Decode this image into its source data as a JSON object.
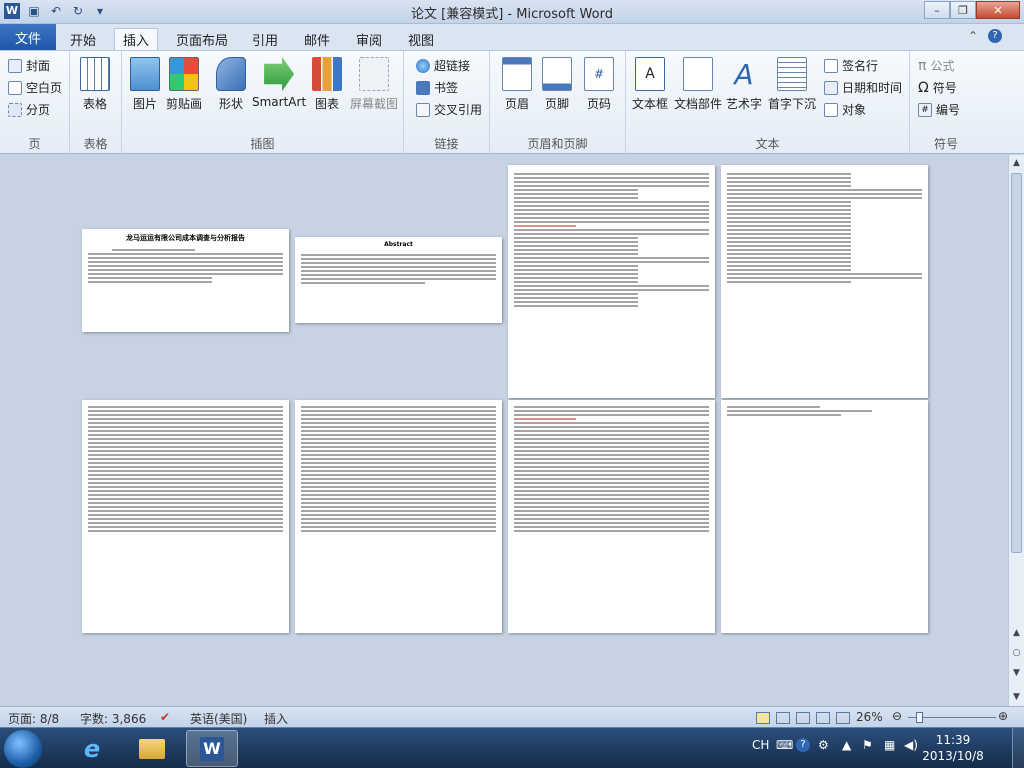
{
  "window": {
    "title": "论文 [兼容模式] - Microsoft Word",
    "minimize": "–",
    "restore": "❐",
    "close": "✕"
  },
  "tabs": {
    "file": "文件",
    "items": [
      "开始",
      "插入",
      "页面布局",
      "引用",
      "邮件",
      "审阅",
      "视图"
    ],
    "active": "插入"
  },
  "ribbon": {
    "pages": {
      "cover": "封面",
      "blank": "空白页",
      "break": "分页",
      "label": "页"
    },
    "tables": {
      "table": "表格",
      "label": "表格"
    },
    "illustrations": {
      "picture": "图片",
      "clipart": "剪贴画",
      "shapes": "形状",
      "smartart": "SmartArt",
      "chart": "图表",
      "screenshot": "屏幕截图",
      "label": "插图"
    },
    "links": {
      "hyperlink": "超链接",
      "bookmark": "书签",
      "crossref": "交叉引用",
      "label": "链接"
    },
    "headerfooter": {
      "header": "页眉",
      "footer": "页脚",
      "pagenum": "页码",
      "label": "页眉和页脚"
    },
    "text": {
      "textbox": "文本框",
      "quickparts": "文档部件",
      "wordart": "艺术字",
      "dropcap": "首字下沉",
      "signature": "签名行",
      "datetime": "日期和时间",
      "object": "对象",
      "label": "文本"
    },
    "symbols": {
      "equation": "公式",
      "symbol": "符号",
      "number": "编号",
      "label": "符号"
    }
  },
  "document": {
    "page1_title": "龙马运运有限公司成本调查与分析报告",
    "page2_title": "Abstract"
  },
  "statusbar": {
    "page": "页面: 8/8",
    "words": "字数: 3,866",
    "language": "英语(美国)",
    "mode": "插入",
    "zoom": "26%"
  },
  "taskbar": {
    "ime": "CH",
    "time": "11:39",
    "date": "2013/10/8"
  }
}
